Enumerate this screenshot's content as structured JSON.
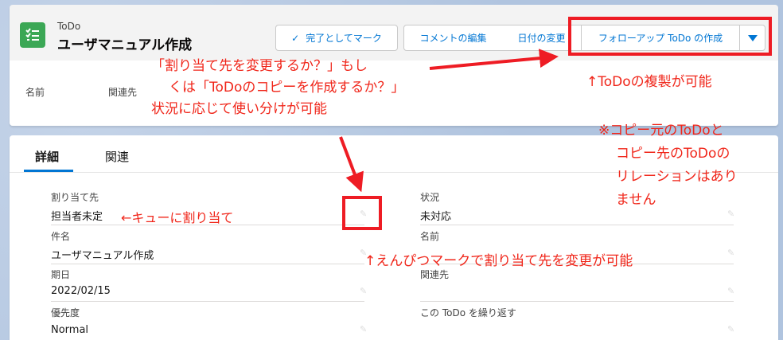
{
  "header": {
    "object_type": "ToDo",
    "record_title": "ユーザマニュアル作成",
    "buttons": {
      "mark_complete": "完了としてマーク",
      "edit_comments": "コメントの編集",
      "change_date": "日付の変更",
      "create_followup": "フォローアップ ToDo の作成"
    },
    "highlights": [
      "名前",
      "関連先"
    ]
  },
  "tabs": [
    {
      "label": "詳細"
    },
    {
      "label": "関連"
    }
  ],
  "details": {
    "assigned_to": {
      "label": "割り当て先",
      "value": "担当者未定"
    },
    "status": {
      "label": "状況",
      "value": "未対応"
    },
    "subject": {
      "label": "件名",
      "value": "ユーザマニュアル作成"
    },
    "name": {
      "label": "名前",
      "value": ""
    },
    "due_date": {
      "label": "期日",
      "value": "2022/02/15"
    },
    "related_to": {
      "label": "関連先",
      "value": ""
    },
    "priority": {
      "label": "優先度",
      "value": "Normal"
    },
    "repeat": {
      "label": "この ToDo を繰り返す",
      "value": ""
    }
  },
  "annotations": {
    "question": [
      "「割り当て先を変更するか？」もし",
      "くは「ToDoのコピーを作成するか？」",
      "状況に応じて使い分けが可能"
    ],
    "duplicate": "↑ToDoの複製が可能",
    "no_relation": [
      "※コピー元のToDoと",
      "コピー先のToDoの",
      "リレーションはあり",
      "ません"
    ],
    "queue": "←キューに割り当て",
    "pencil_note": "↑えんぴつマークで割り当て先を変更が可能"
  },
  "colors": {
    "accent": "#0176d3",
    "annotation_red": "#ee1c24",
    "todo_icon": "#3ba755"
  }
}
